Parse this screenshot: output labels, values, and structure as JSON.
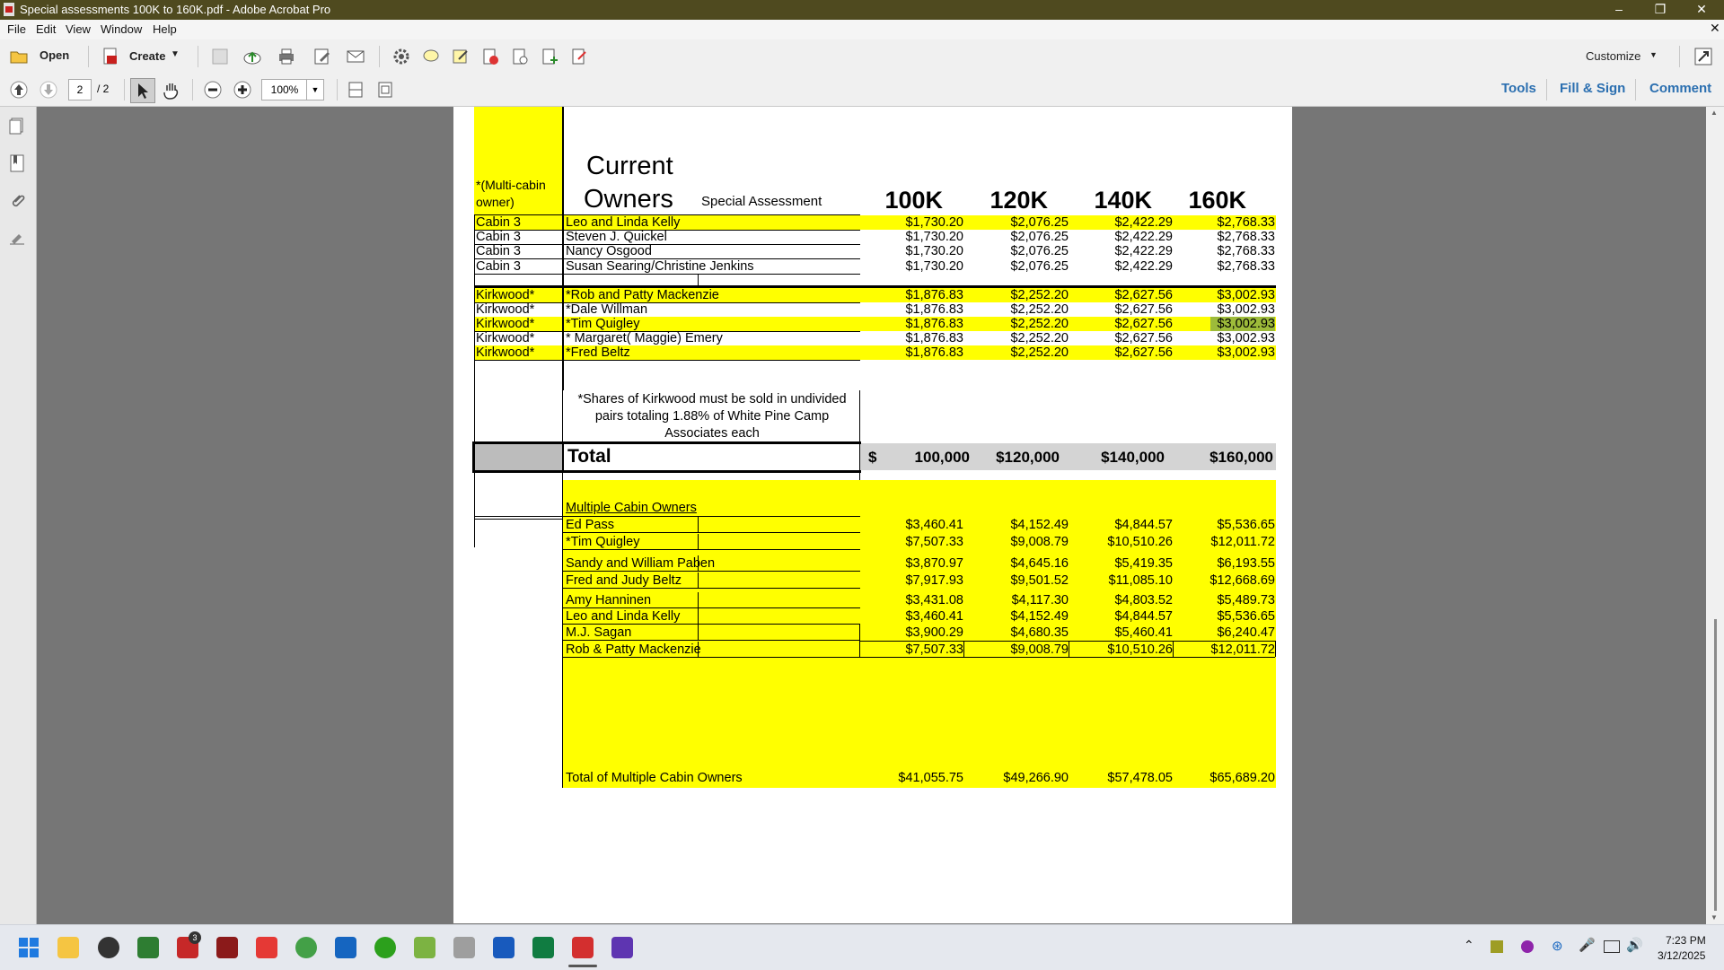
{
  "window": {
    "title": "Special assessments 100K to 160K.pdf - Adobe Acrobat Pro"
  },
  "menu": [
    "File",
    "Edit",
    "View",
    "Window",
    "Help"
  ],
  "toolbar": {
    "open": "Open",
    "create": "Create",
    "customize": "Customize"
  },
  "nav": {
    "page": "2",
    "page_total": "/ 2",
    "zoom": "100%",
    "tools": "Tools",
    "fill_sign": "Fill & Sign",
    "comment": "Comment"
  },
  "doc": {
    "multi_cabin_label": "*(Multi-cabin owner)",
    "current_owners_line1": "Current",
    "current_owners_line2": "Owners",
    "special_assessment": "Special Assessment",
    "col_headers": [
      "100K",
      "120K",
      "140K",
      "160K"
    ],
    "rows": [
      {
        "cabin": "Cabin 3",
        "owner": "Leo and Linda Kelly",
        "v": [
          "$1,730.20",
          "$2,076.25",
          "$2,422.29",
          "$2,768.33"
        ],
        "yellow": true
      },
      {
        "cabin": "Cabin 3",
        "owner": "Steven J. Quickel",
        "v": [
          "$1,730.20",
          "$2,076.25",
          "$2,422.29",
          "$2,768.33"
        ],
        "yellow": false
      },
      {
        "cabin": "Cabin 3",
        "owner": "Nancy Osgood",
        "v": [
          "$1,730.20",
          "$2,076.25",
          "$2,422.29",
          "$2,768.33"
        ],
        "yellow": false
      },
      {
        "cabin": "Cabin 3",
        "owner": "Susan Searing/Christine Jenkins",
        "v": [
          "$1,730.20",
          "$2,076.25",
          "$2,422.29",
          "$2,768.33"
        ],
        "yellow": false
      },
      {
        "cabin": "Kirkwood*",
        "owner": "*Rob and Patty Mackenzie",
        "v": [
          "$1,876.83",
          "$2,252.20",
          "$2,627.56",
          "$3,002.93"
        ],
        "yellow": true
      },
      {
        "cabin": "Kirkwood*",
        "owner": "*Dale Willman",
        "v": [
          "$1,876.83",
          "$2,252.20",
          "$2,627.56",
          "$3,002.93"
        ],
        "yellow": false
      },
      {
        "cabin": "Kirkwood*",
        "owner": "*Tim Quigley",
        "v": [
          "$1,876.83",
          "$2,252.20",
          "$2,627.56",
          "$3,002.93"
        ],
        "yellow": true
      },
      {
        "cabin": "Kirkwood*",
        "owner": "* Margaret( Maggie)  Emery",
        "v": [
          "$1,876.83",
          "$2,252.20",
          "$2,627.56",
          "$3,002.93"
        ],
        "yellow": false
      },
      {
        "cabin": "Kirkwood*",
        "owner": "*Fred Beltz",
        "v": [
          "$1,876.83",
          "$2,252.20",
          "$2,627.56",
          "$3,002.93"
        ],
        "yellow": true
      }
    ],
    "kirkwood_note": [
      "*Shares of Kirkwood must be sold in undivided",
      "pairs totaling 1.88% of White Pine Camp",
      "Associates each"
    ],
    "total_label": "Total",
    "total_dollar": "$",
    "totals": [
      "100,000",
      "$120,000",
      "$140,000",
      "$160,000"
    ],
    "multi_title": "Multiple Cabin Owners",
    "multi_rows": [
      {
        "owner": "Ed Pass",
        "v": [
          "$3,460.41",
          "$4,152.49",
          "$4,844.57",
          "$5,536.65"
        ]
      },
      {
        "owner": "*Tim Quigley",
        "v": [
          "$7,507.33",
          "$9,008.79",
          "$10,510.26",
          "$12,011.72"
        ]
      },
      {
        "owner": "Sandy and William Paben",
        "v": [
          "$3,870.97",
          "$4,645.16",
          "$5,419.35",
          "$6,193.55"
        ]
      },
      {
        "owner": "Fred and Judy Beltz",
        "v": [
          "$7,917.93",
          "$9,501.52",
          "$11,085.10",
          "$12,668.69"
        ]
      },
      {
        "owner": "Amy Hanninen",
        "v": [
          "$3,431.08",
          "$4,117.30",
          "$4,803.52",
          "$5,489.73"
        ]
      },
      {
        "owner": "Leo and Linda Kelly",
        "v": [
          "$3,460.41",
          "$4,152.49",
          "$4,844.57",
          "$5,536.65"
        ]
      },
      {
        "owner": "M.J. Sagan",
        "v": [
          "$3,900.29",
          "$4,680.35",
          "$5,460.41",
          "$6,240.47"
        ]
      },
      {
        "owner": "Rob & Patty Mackenzie",
        "v": [
          "$7,507.33",
          "$9,008.79",
          "$10,510.26",
          "$12,011.72"
        ]
      }
    ],
    "multi_total_label": "Total of Multiple Cabin Owners",
    "multi_totals": [
      "$41,055.75",
      "$49,266.90",
      "$57,478.05",
      "$65,689.20"
    ]
  },
  "taskbar": {
    "time": "7:23 PM",
    "date": "3/12/2025",
    "badge": "3"
  },
  "colors": {
    "title_bar": "#4f4a1f",
    "highlight": "#ffff00",
    "link": "#2b6fb0"
  }
}
